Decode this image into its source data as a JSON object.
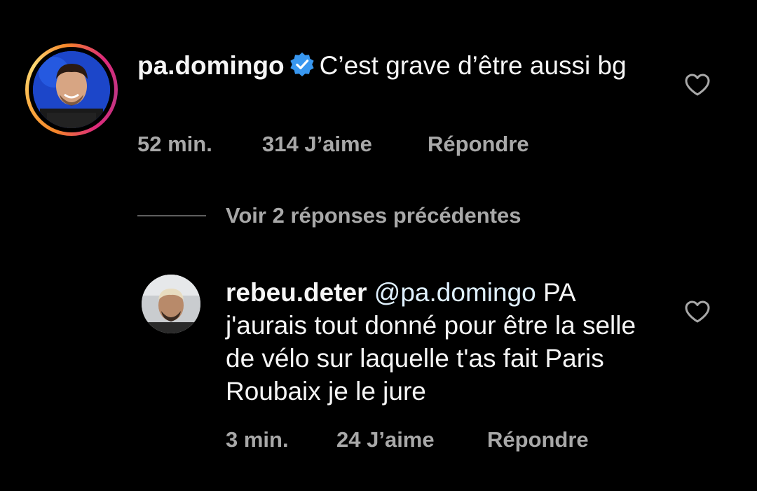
{
  "comments": [
    {
      "username": "pa.domingo",
      "verified": true,
      "text": "C’est grave d’être aussi bg",
      "time": "52 min.",
      "likes": "314 J’aime",
      "reply_label": "Répondre",
      "avatar_ring": "story-gradient"
    },
    {
      "username": "rebeu.deter",
      "mention": "@pa.domingo",
      "text": "PA j'aurais tout donné pour être la selle de vélo sur laquelle t'as fait Paris Roubaix je le jure",
      "time": "3 min.",
      "likes": "24 J’aime",
      "reply_label": "Répondre"
    }
  ],
  "view_replies": {
    "label": "Voir 2 réponses précédentes"
  },
  "icons": {
    "like": "heart-outline-icon",
    "verified": "verified-badge-icon"
  },
  "colors": {
    "background": "#000000",
    "text": "#f5f5f5",
    "secondary": "#a8a8a8",
    "verified": "#3897f0",
    "mention": "#e0f1ff"
  }
}
